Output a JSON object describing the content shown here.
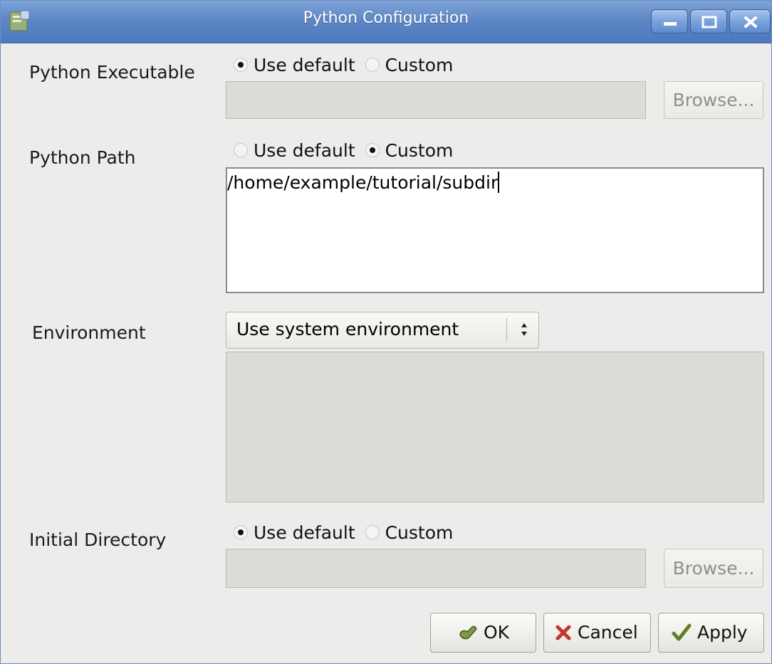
{
  "window": {
    "title": "Python Configuration"
  },
  "executable": {
    "label": "Python Executable",
    "opt_default": "Use default",
    "opt_custom": "Custom",
    "selected": "default",
    "path_value": "",
    "browse": "Browse..."
  },
  "python_path": {
    "label": "Python Path",
    "opt_default": "Use default",
    "opt_custom": "Custom",
    "selected": "custom",
    "value": "/home/example/tutorial/subdir"
  },
  "environment": {
    "label": "Environment",
    "selected": "Use system environment"
  },
  "initial_dir": {
    "label": "Initial Directory",
    "opt_default": "Use default",
    "opt_custom": "Custom",
    "selected": "default",
    "browse": "Browse..."
  },
  "buttons": {
    "ok": "OK",
    "cancel": "Cancel",
    "apply": "Apply"
  },
  "colors": {
    "titlebar": "#5e87c6",
    "dialog_bg": "#ececea",
    "field_disabled": "#dcdcd7"
  }
}
